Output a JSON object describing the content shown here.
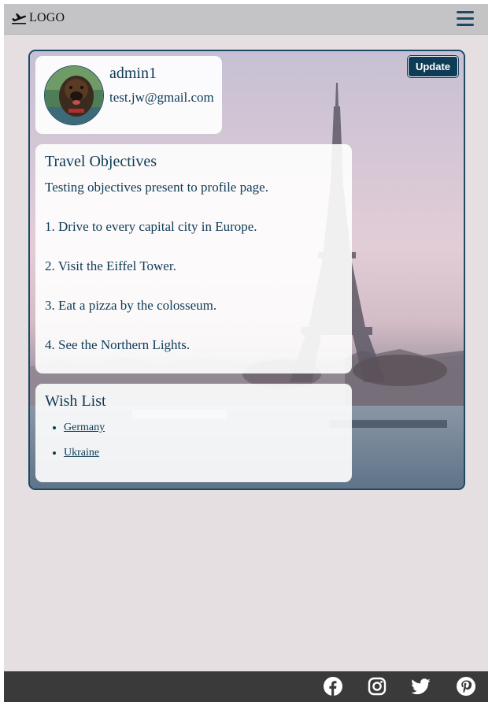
{
  "navbar": {
    "logo_text": "LOGO",
    "logo_icon": "airplane-departure-icon",
    "menu_icon": "hamburger-menu-icon"
  },
  "profile": {
    "update_label": "Update",
    "username": "admin1",
    "email": "test.jw@gmail.com"
  },
  "objectives": {
    "title": "Travel Objectives",
    "text": "Testing objectives present to profile page.\n\n1. Drive to every capital city in Europe.\n\n2. Visit the Eiffel Tower.\n\n3. Eat a pizza by the colosseum.\n\n4. See the Northern Lights."
  },
  "wishlist": {
    "title": "Wish List",
    "items": [
      "Germany",
      "Ukraine"
    ]
  },
  "footer": {
    "icons": [
      "facebook-icon",
      "instagram-icon",
      "twitter-icon",
      "pinterest-icon"
    ]
  },
  "colors": {
    "primary": "#0e3b55",
    "navbar_bg": "#c4c4c6",
    "page_bg": "#e6dfe2",
    "footer_bg": "#3a3a3a"
  }
}
